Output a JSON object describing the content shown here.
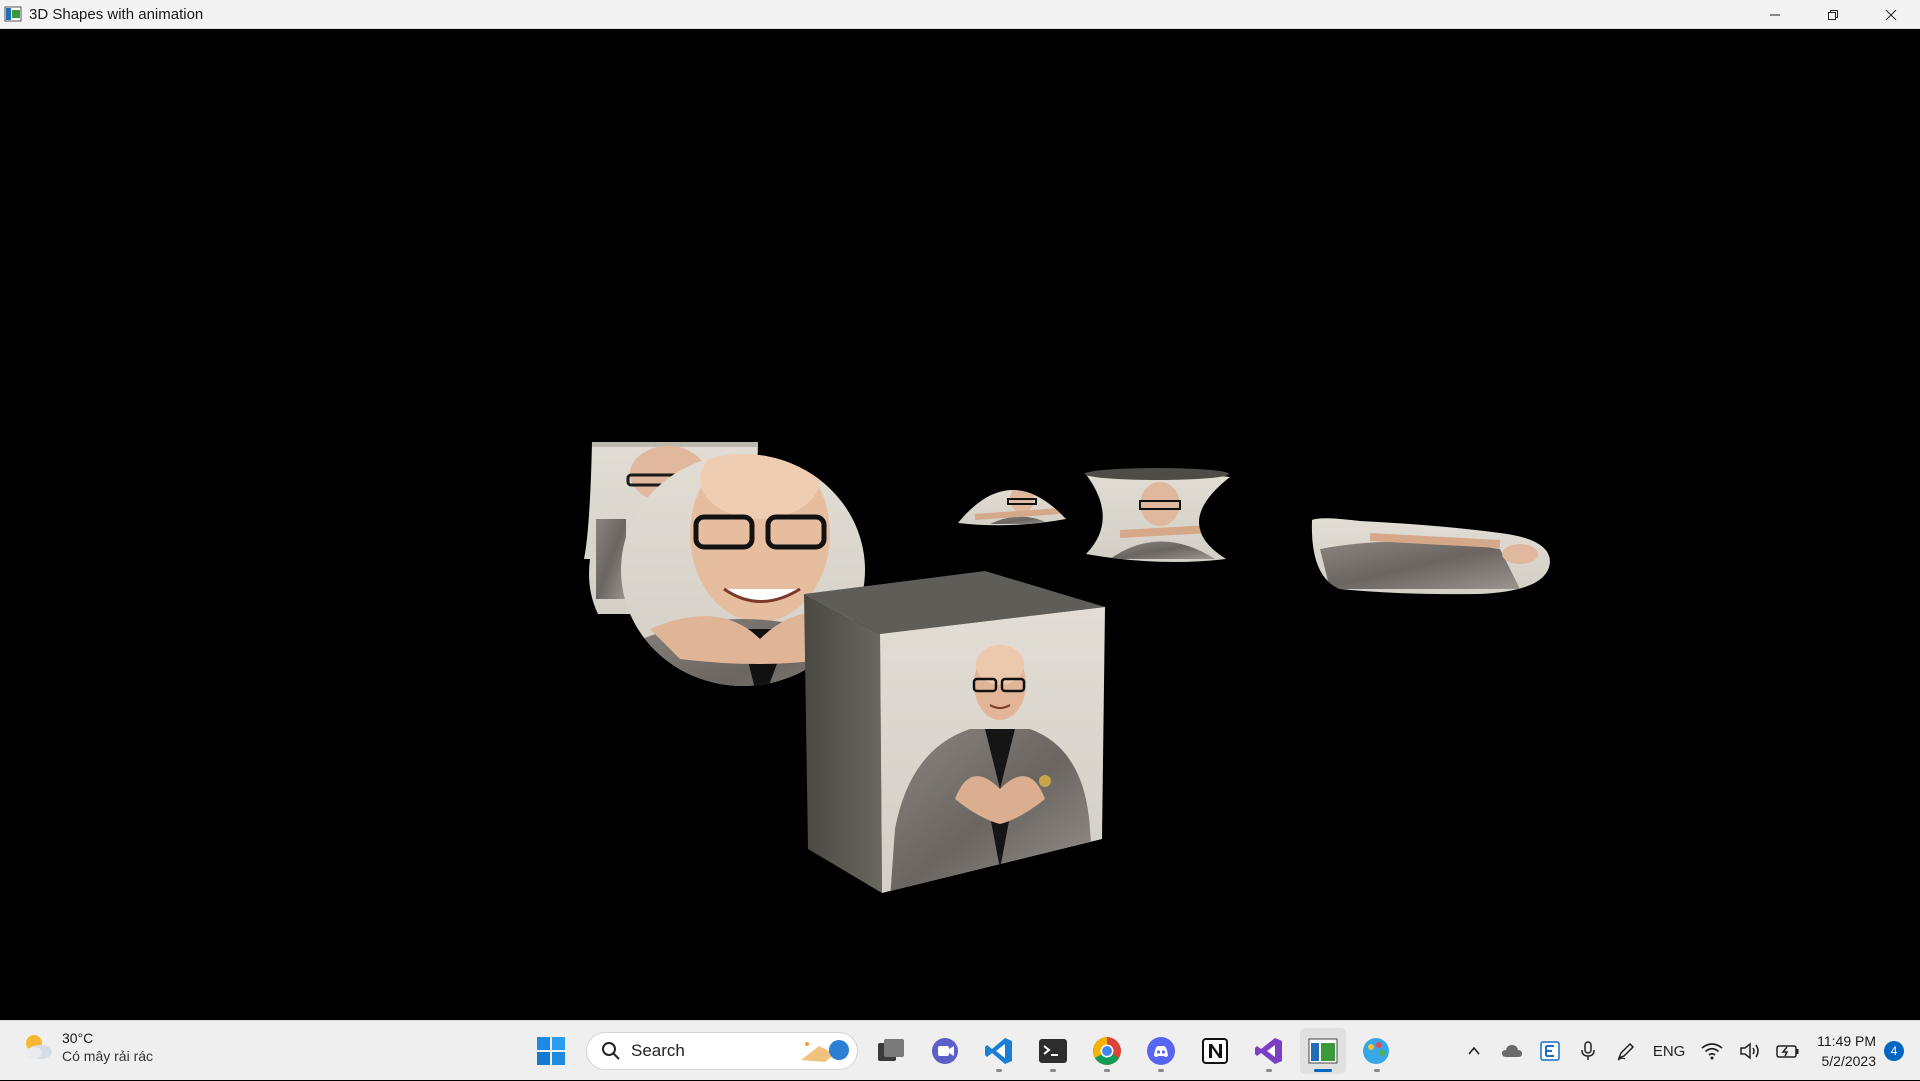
{
  "window": {
    "title": "3D Shapes with animation"
  },
  "scene": {
    "background": "#000000",
    "objects": [
      "cylinder",
      "sphere",
      "cone",
      "hourglass",
      "torus",
      "cube"
    ]
  },
  "taskbar": {
    "weather": {
      "temp": "30°C",
      "condition": "Có mây rải rác"
    },
    "search": {
      "placeholder": "Search"
    },
    "pinned": [
      "start-icon",
      "task-view-icon",
      "teams-chat-icon",
      "vscode-icon",
      "terminal-icon",
      "chrome-icon",
      "discord-icon",
      "notion-icon",
      "visual-studio-icon",
      "opengl-app-icon",
      "paint-icon"
    ],
    "tray": {
      "language": "ENG",
      "time": "11:49 PM",
      "date": "5/2/2023",
      "notifications": "4"
    }
  },
  "colors": {
    "accent": "#0067c0",
    "taskbar_bg": "#efefef"
  }
}
